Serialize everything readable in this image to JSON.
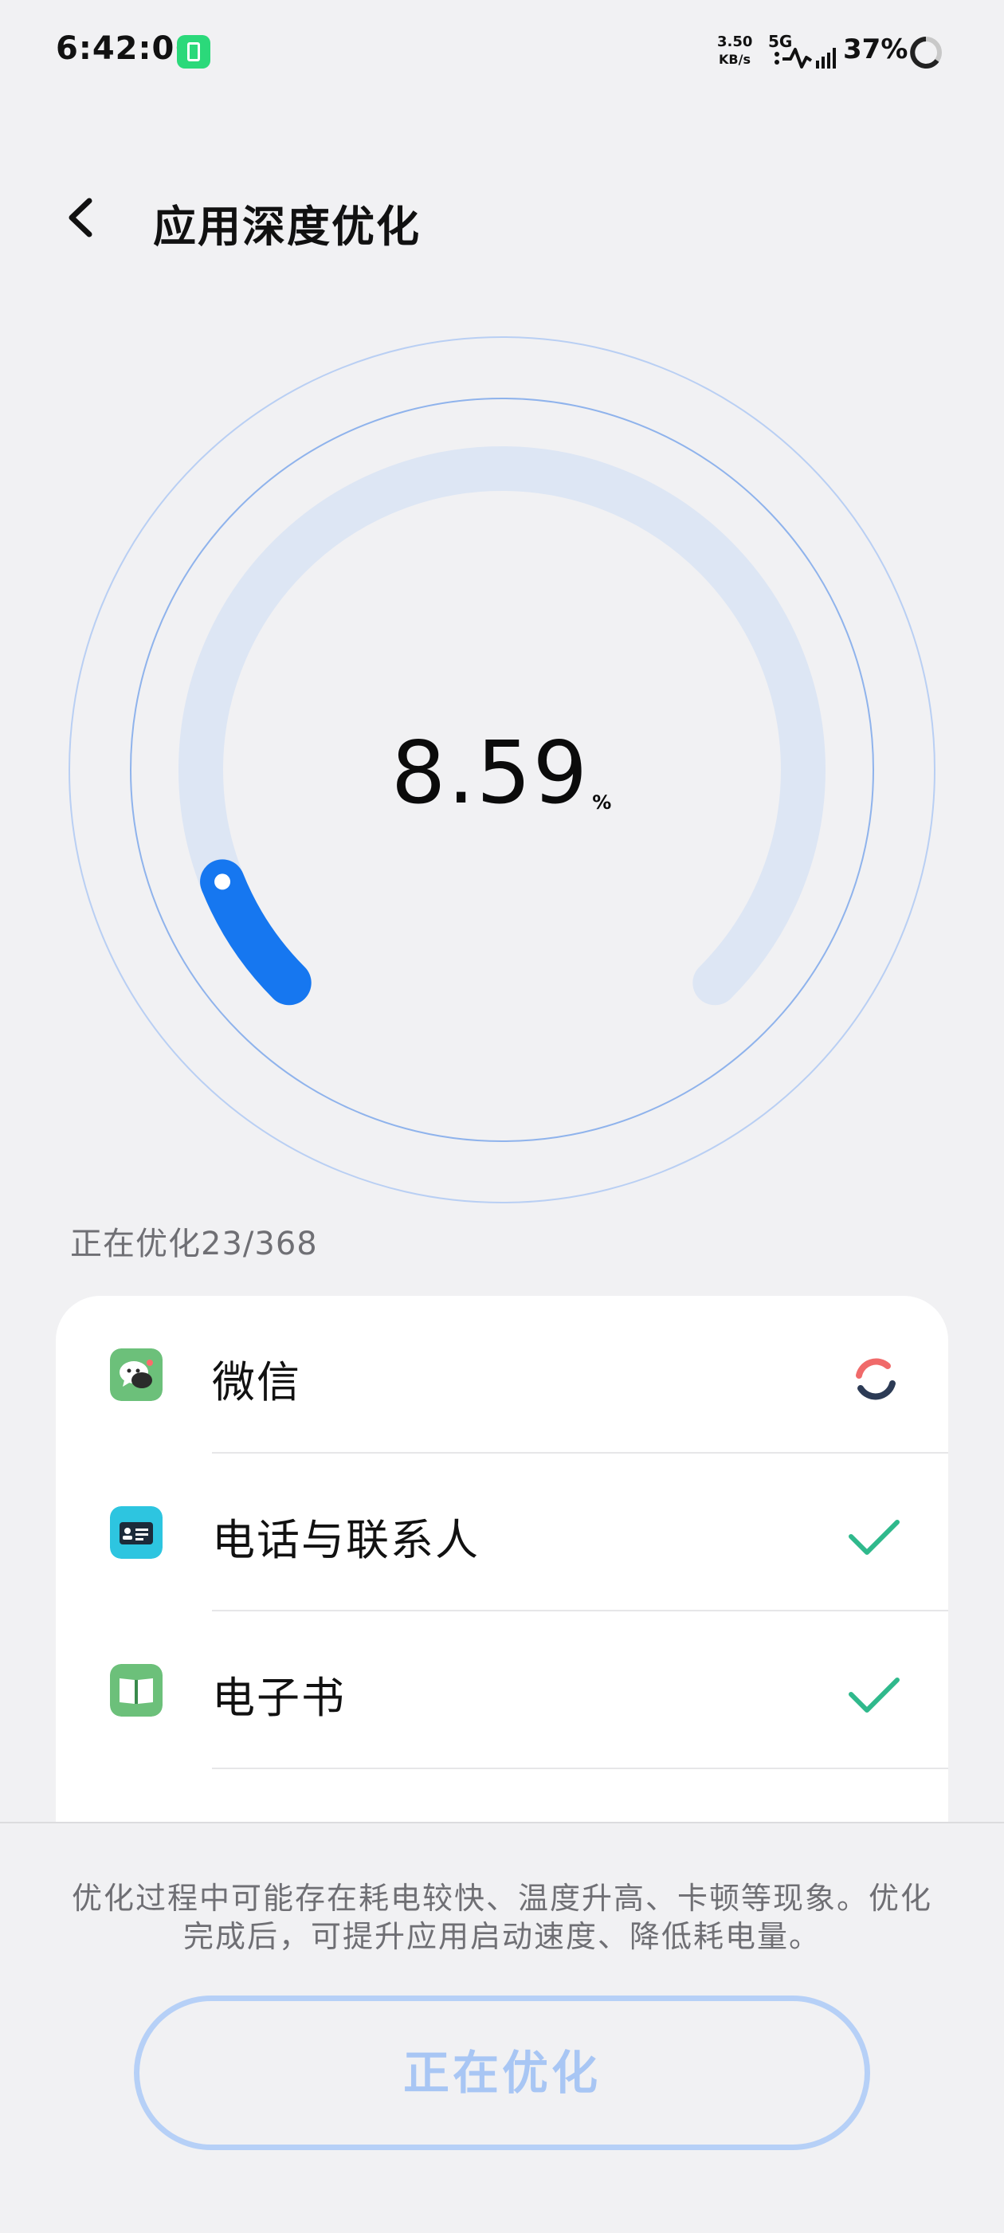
{
  "status_bar": {
    "time": "6:42:06",
    "net_speed_value": "3.50",
    "net_speed_unit": "KB/s",
    "network_type": "5G",
    "battery_percent": "37%"
  },
  "header": {
    "title": "应用深度优化"
  },
  "gauge": {
    "value": "8.59",
    "unit": "%",
    "progress_fraction": 0.0859
  },
  "progress": {
    "label": "正在优化",
    "count": "23/368"
  },
  "apps": [
    {
      "name": "微信",
      "status": "optimizing",
      "icon": "wechat-icon",
      "icon_color": "#6cc07a"
    },
    {
      "name": "电话与联系人",
      "status": "done",
      "icon": "contact-card-icon",
      "icon_color": "#2dc5e0"
    },
    {
      "name": "电子书",
      "status": "done",
      "icon": "book-icon",
      "icon_color": "#6cc07a"
    }
  ],
  "notice": {
    "text": "优化过程中可能存在耗电较快、温度升高、卡顿等现象。优化完成后，可提升应用启动速度、降低耗电量。"
  },
  "button": {
    "label": "正在优化"
  },
  "colors": {
    "accent": "#1677f0",
    "track": "#dde6f4",
    "ring": "#a9c5f2",
    "check": "#2fb98c",
    "button_border": "#b6d0f7"
  }
}
